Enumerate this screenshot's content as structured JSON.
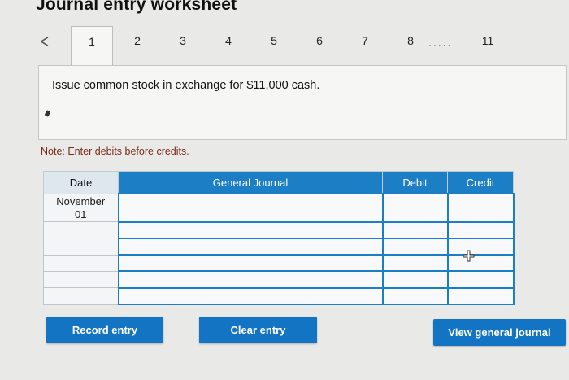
{
  "title": "Journal entry worksheet",
  "tabs": {
    "prev_glyph": "<",
    "items": [
      "1",
      "2",
      "3",
      "4",
      "5",
      "6",
      "7",
      "8",
      "11"
    ],
    "ellipsis": "....."
  },
  "question": "Issue common stock in exchange for $11,000 cash.",
  "note": "Note: Enter debits before credits.",
  "table": {
    "headers": {
      "date": "Date",
      "journal": "General Journal",
      "debit": "Debit",
      "credit": "Credit"
    },
    "first_date_month": "November",
    "first_date_day": "01",
    "row_count": 6
  },
  "buttons": {
    "record": "Record entry",
    "clear": "Clear entry",
    "view": "View general journal"
  },
  "colors": {
    "accent": "#1474c4",
    "header": "#1c7ec4",
    "note": "#7a2a1a"
  }
}
